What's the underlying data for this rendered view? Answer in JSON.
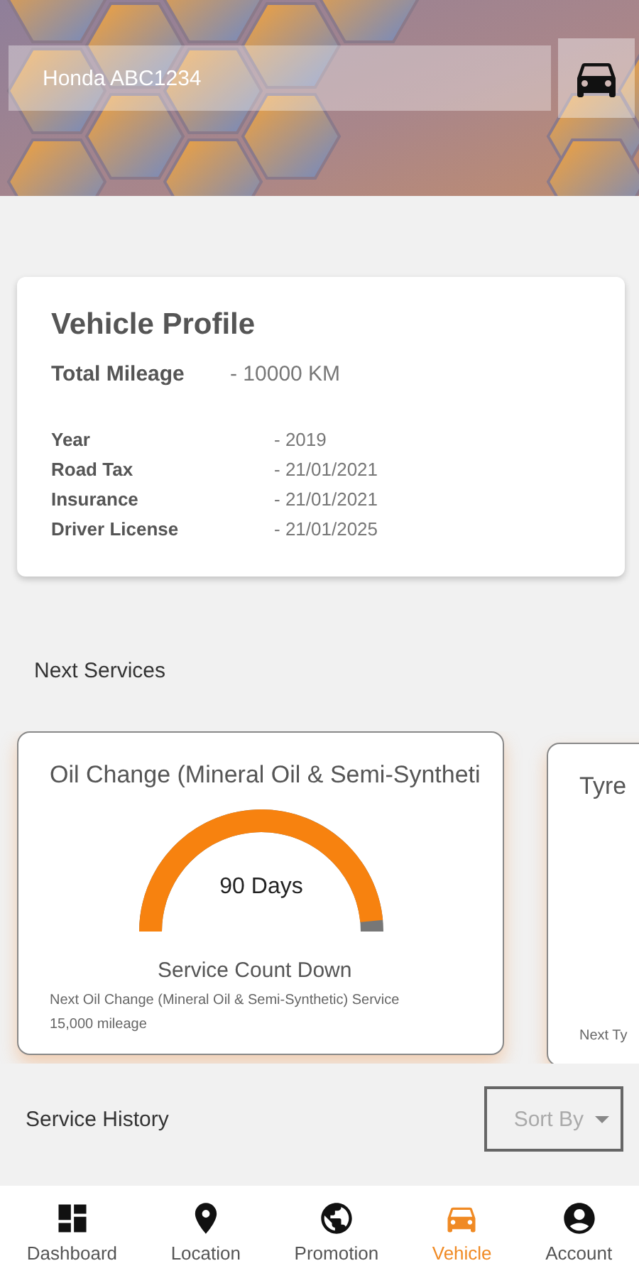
{
  "header": {
    "vehicle_field": {
      "value": "Honda ABC1234"
    }
  },
  "vehicle_profile": {
    "title": "Vehicle Profile",
    "mileage": {
      "label": "Total Mileage",
      "value": "- 10000 KM"
    },
    "details": [
      {
        "label": "Year",
        "value": "- 2019"
      },
      {
        "label": "Road Tax",
        "value": "- 21/01/2021"
      },
      {
        "label": "Insurance",
        "value": "- 21/01/2021"
      },
      {
        "label": "Driver License",
        "value": "- 21/01/2025"
      }
    ]
  },
  "next_services": {
    "title": "Next Services",
    "cards": [
      {
        "title": "Oil Change (Mineral Oil & Semi-Syntheti",
        "gauge": {
          "reading": "90 Days"
        },
        "caption": "Service Count Down",
        "note": "Next Oil Change (Mineral Oil & Semi-Synthetic) Service",
        "mileage": "15,000 mileage"
      },
      {
        "title": "Tyre",
        "note": "Next Ty"
      }
    ]
  },
  "service_history": {
    "title": "Service History",
    "sort": {
      "label": "Sort By"
    }
  },
  "bottom_nav": [
    {
      "label": "Dashboard",
      "kind": "dashboard",
      "selected": false
    },
    {
      "label": "Location",
      "kind": "location",
      "selected": false
    },
    {
      "label": "Promotion",
      "kind": "globe",
      "selected": false
    },
    {
      "label": "Vehicle",
      "kind": "car",
      "selected": true
    },
    {
      "label": "Account",
      "kind": "account",
      "selected": false
    }
  ]
}
